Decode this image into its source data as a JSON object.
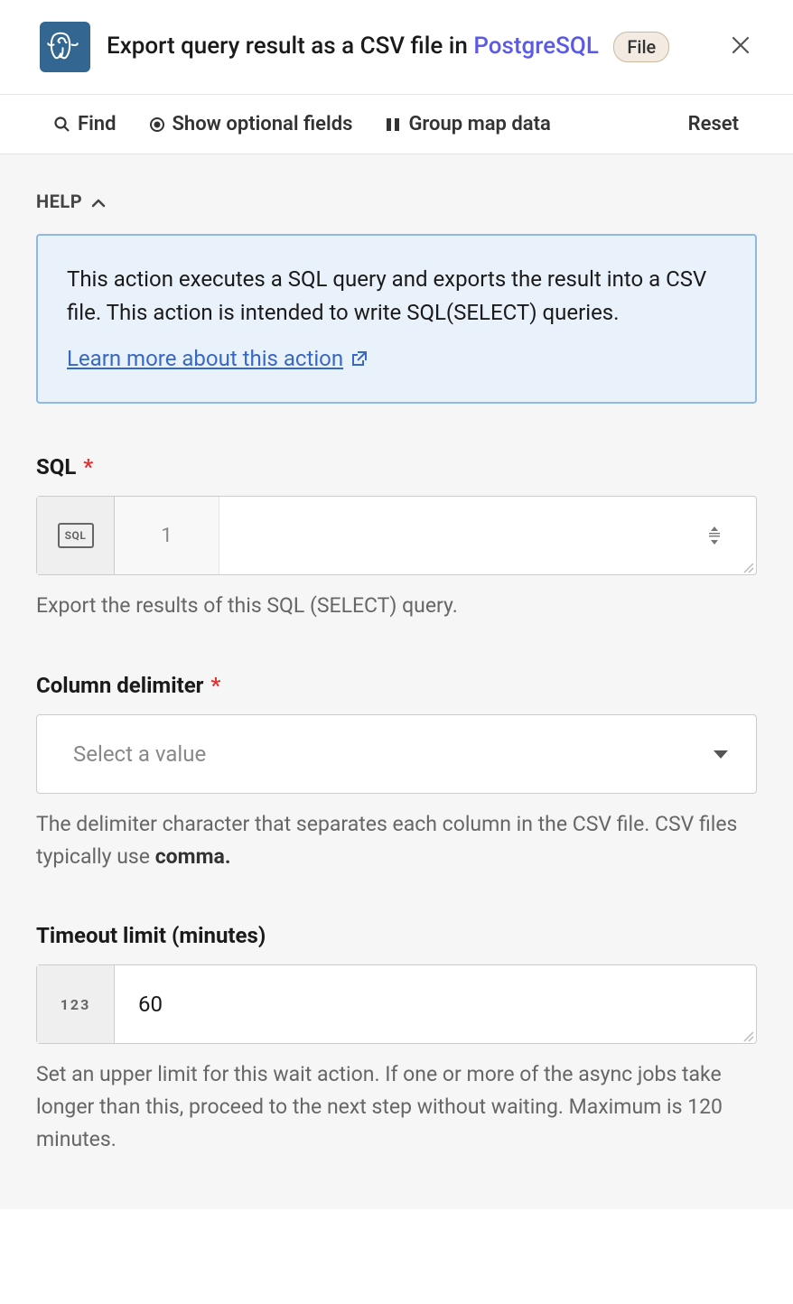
{
  "header": {
    "title_prefix": "Export query result as a CSV file in ",
    "title_link": "PostgreSQL",
    "badge": "File"
  },
  "toolbar": {
    "find": "Find",
    "show_optional": "Show optional fields",
    "group_map": "Group map data",
    "reset": "Reset"
  },
  "help": {
    "header": "HELP",
    "text": "This action executes a SQL query and exports the result into a CSV file. This action is intended to write SQL(SELECT) queries.",
    "link": "Learn more about this action"
  },
  "fields": {
    "sql": {
      "label": "SQL",
      "icon": "SQL",
      "line_num": "1",
      "value": "",
      "hint": "Export the results of this SQL (SELECT) query."
    },
    "delimiter": {
      "label": "Column delimiter",
      "placeholder": "Select a value",
      "hint_prefix": "The delimiter character that separates each column in the CSV file. CSV files typically use ",
      "hint_bold": "comma."
    },
    "timeout": {
      "label": "Timeout limit (minutes)",
      "icon": "123",
      "value": "60",
      "hint": "Set an upper limit for this wait action. If one or more of the async jobs take longer than this, proceed to the next step without waiting. Maximum is 120 minutes."
    }
  }
}
